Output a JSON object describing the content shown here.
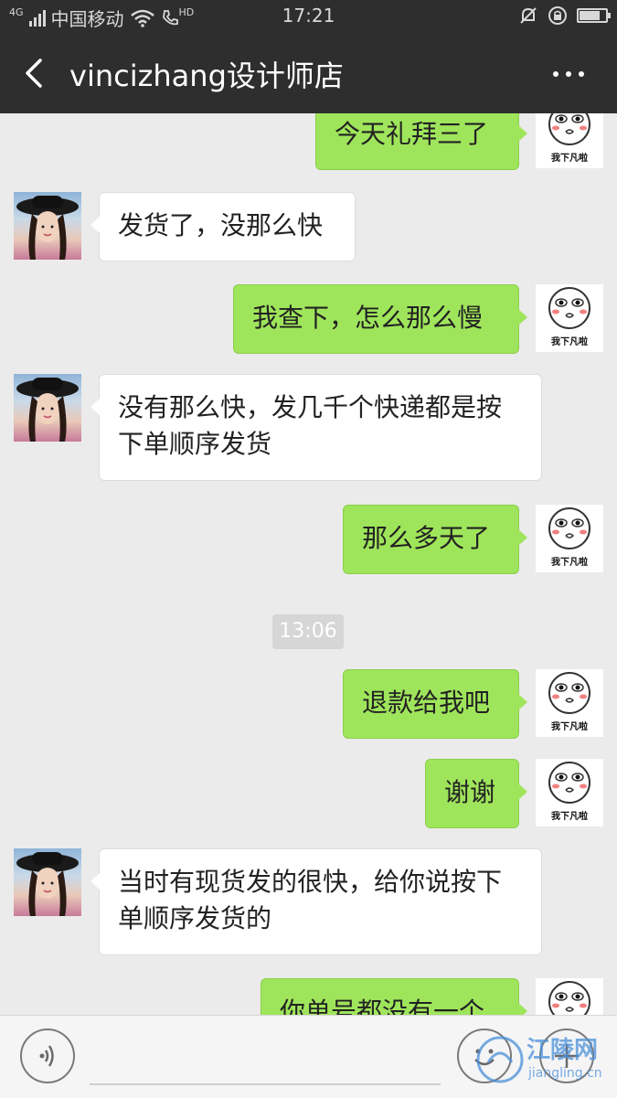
{
  "status_bar": {
    "network": "4G",
    "carrier": "中国移动",
    "hd_label": "HD",
    "time": "17:21"
  },
  "header": {
    "title": "vincizhang设计师店"
  },
  "meme_caption": "我下凡啦",
  "messages": [
    {
      "side": "right",
      "text": "今天礼拜三了"
    },
    {
      "side": "left",
      "text": "发货了，没那么快"
    },
    {
      "side": "right",
      "text": "我查下，怎么那么慢"
    },
    {
      "side": "left",
      "text": "没有那么快，发几千个快递都是按下单顺序发货"
    },
    {
      "side": "right",
      "text": "那么多天了"
    },
    {
      "side": "right",
      "text": "退款给我吧"
    },
    {
      "side": "right",
      "text": "谢谢"
    },
    {
      "side": "left",
      "text": "当时有现货发的很快，给你说按下单顺序发货的"
    },
    {
      "side": "right",
      "text": "你单号都没有一个"
    }
  ],
  "timestamp": "13:06",
  "watermark": {
    "brand": "江陵网",
    "domain": "jiangling.cn"
  },
  "colors": {
    "bar": "#2e2e2e",
    "chat_bg": "#ebebeb",
    "sent_bubble": "#9fe55b",
    "received_bubble": "#ffffff"
  }
}
